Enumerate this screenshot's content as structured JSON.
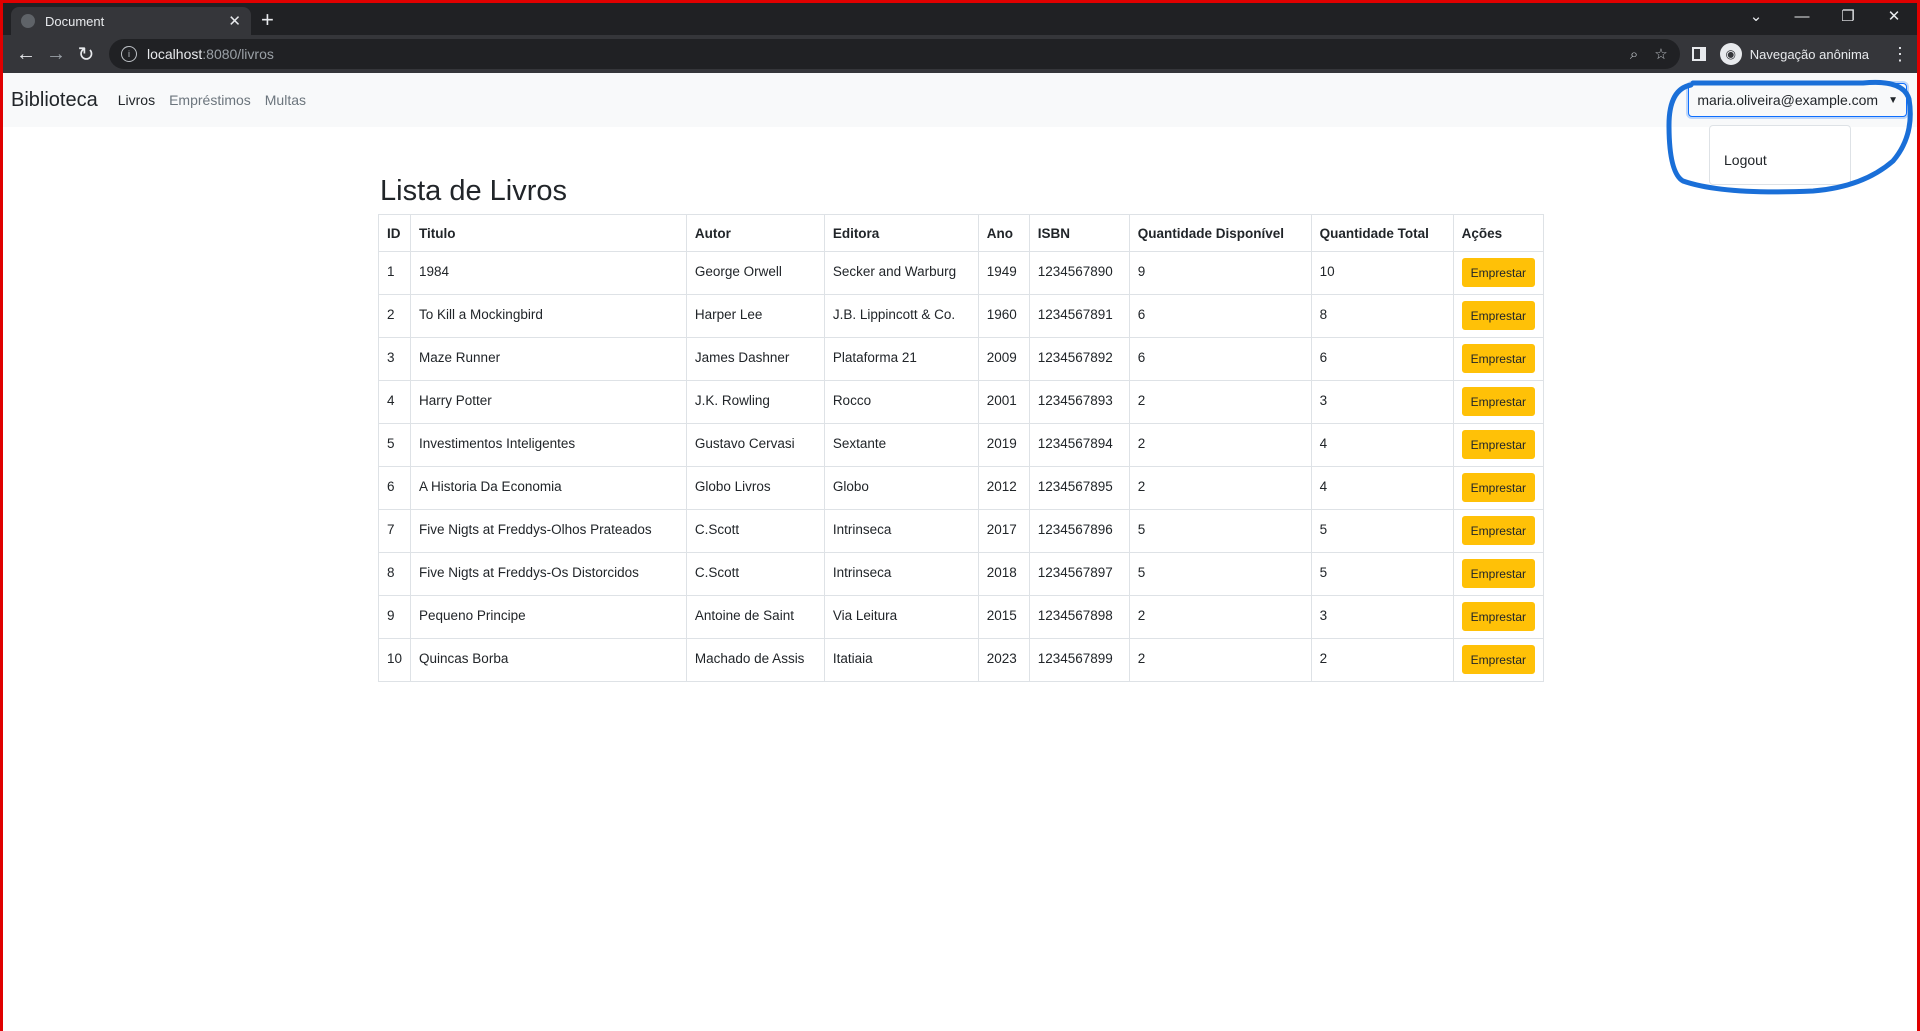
{
  "browser": {
    "tab_title": "Document",
    "url_host": "localhost",
    "url_path": ":8080/livros",
    "incognito_label": "Navegação anônima"
  },
  "app": {
    "brand": "Biblioteca",
    "nav": [
      "Livros",
      "Empréstimos",
      "Multas"
    ],
    "user_email": "maria.oliveira@example.com",
    "logout_label": "Logout"
  },
  "page": {
    "title": "Lista de Livros",
    "columns": [
      "ID",
      "Titulo",
      "Autor",
      "Editora",
      "Ano",
      "ISBN",
      "Quantidade Disponível",
      "Quantidade Total",
      "Ações"
    ],
    "action_label": "Emprestar",
    "rows": [
      [
        "1",
        "1984",
        "George Orwell",
        "Secker and Warburg",
        "1949",
        "1234567890",
        "9",
        "10"
      ],
      [
        "2",
        "To Kill a Mockingbird",
        "Harper Lee",
        "J.B. Lippincott & Co.",
        "1960",
        "1234567891",
        "6",
        "8"
      ],
      [
        "3",
        "Maze Runner",
        "James Dashner",
        "Plataforma 21",
        "2009",
        "1234567892",
        "6",
        "6"
      ],
      [
        "4",
        "Harry Potter",
        "J.K. Rowling",
        "Rocco",
        "2001",
        "1234567893",
        "2",
        "3"
      ],
      [
        "5",
        "Investimentos Inteligentes",
        "Gustavo Cervasi",
        "Sextante",
        "2019",
        "1234567894",
        "2",
        "4"
      ],
      [
        "6",
        "A Historia Da Economia",
        "Globo Livros",
        "Globo",
        "2012",
        "1234567895",
        "2",
        "4"
      ],
      [
        "7",
        "Five Nigts at Freddys-Olhos Prateados",
        "C.Scott",
        "Intrinseca",
        "2017",
        "1234567896",
        "5",
        "5"
      ],
      [
        "8",
        "Five Nigts at Freddys-Os Distorcidos",
        "C.Scott",
        "Intrinseca",
        "2018",
        "1234567897",
        "5",
        "5"
      ],
      [
        "9",
        "Pequeno Principe",
        "Antoine de Saint",
        "Via Leitura",
        "2015",
        "1234567898",
        "2",
        "3"
      ],
      [
        "10",
        "Quincas Borba",
        "Machado de Assis",
        "Itatiaia",
        "2023",
        "1234567899",
        "2",
        "2"
      ]
    ]
  }
}
